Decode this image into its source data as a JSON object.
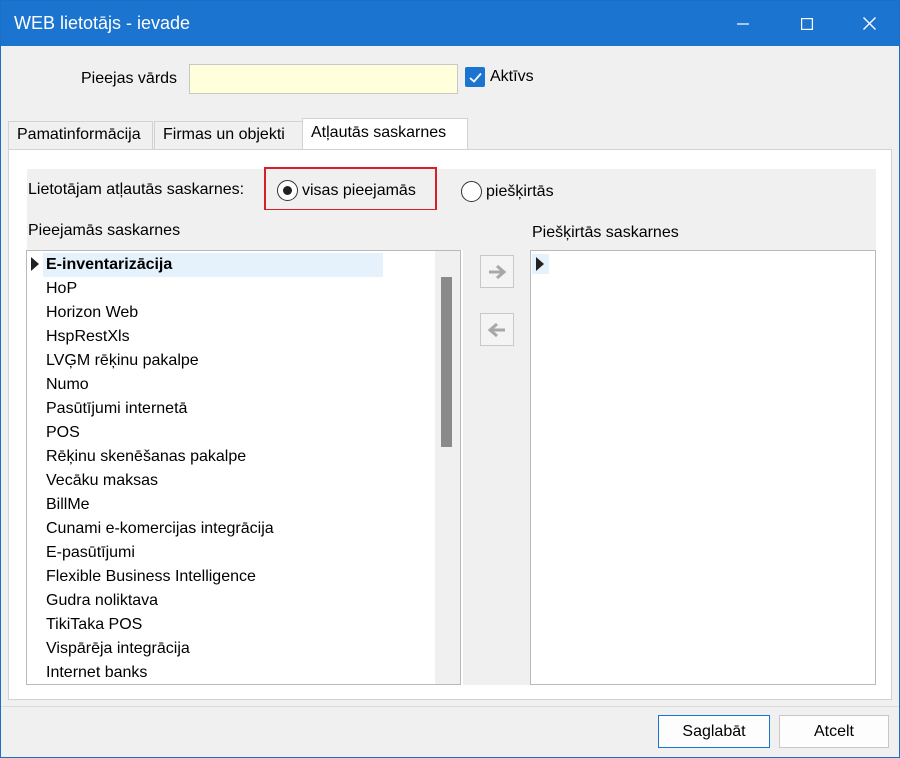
{
  "window": {
    "title": "WEB lietotājs - ievade",
    "controls": [
      "minimize-icon",
      "maximize-icon",
      "close-icon"
    ],
    "titlebar_color": "#1b74cf"
  },
  "form": {
    "access_name_label": "Pieejas vārds",
    "access_name_value": "",
    "active_checked": true,
    "active_label": "Aktīvs"
  },
  "tabs": [
    {
      "label": "Pamatinformācija",
      "active": false
    },
    {
      "label": "Firmas un objekti",
      "active": false
    },
    {
      "label": "Atļautās saskarnes",
      "active": true
    }
  ],
  "allowed": {
    "label": "Lietotājam atļautās saskarnes:",
    "options": [
      {
        "label": "visas pieejamās",
        "selected": true
      },
      {
        "label": "piešķirtās",
        "selected": false
      }
    ],
    "highlight_color": "#d81f26"
  },
  "available": {
    "label": "Pieejamās saskarnes",
    "items": [
      "E-inventarizācija",
      "HoP",
      "Horizon Web",
      "HspRestXls",
      "LVĢM rēķinu pakalpe",
      "Numo",
      "Pasūtījumi internetā",
      "POS",
      "Rēķinu skenēšanas pakalpe",
      "Vecāku maksas",
      "BillMe",
      "Cunami e-komercijas integrācija",
      "E-pasūtījumi",
      "Flexible Business Intelligence",
      "Gudra noliktava",
      "TikiTaka POS",
      "Vispārēja integrācija",
      "Internet banks"
    ],
    "selected_index": 0
  },
  "transfer_buttons": [
    "arrow-right-icon",
    "arrow-left-icon"
  ],
  "assigned": {
    "label": "Piešķirtās saskarnes",
    "items": []
  },
  "footer": {
    "save_label": "Saglabāt",
    "cancel_label": "Atcelt"
  }
}
